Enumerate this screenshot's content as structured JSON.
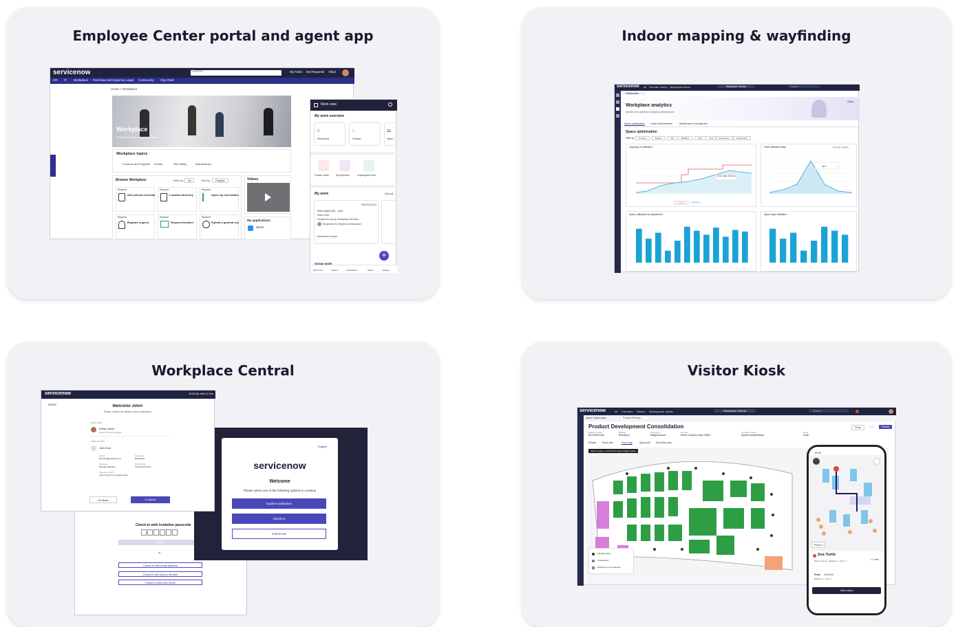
{
  "cards": [
    {
      "title": "Employee Center portal and agent app"
    },
    {
      "title": "Indoor mapping & wayfinding"
    },
    {
      "title": "Workplace Central"
    },
    {
      "title": "Visitor Kiosk"
    }
  ],
  "ec": {
    "logo": "servicenow",
    "search": "Search",
    "nav_links": [
      "My Tasks",
      "My Requests",
      "Viktor"
    ],
    "menu": [
      "HR",
      "IT",
      "Workplace",
      "Purchase and Expense",
      "Legal",
      "Community",
      "Org Chart"
    ],
    "breadcrumb": "Home  >  Workplace",
    "hero_title": "Workplace",
    "hero_sub": "Solutions to your workplace needs",
    "topics_title": "Workplace topics",
    "topics": [
      "Furniture and Supplies",
      "Events",
      "Site Safety",
      "Maintenance"
    ],
    "browse_title": "Browse Workplace",
    "filter_label": "Filter by:",
    "filter_value": "All",
    "sort_label": "Sort by:",
    "sort_value": "Popular",
    "items": [
      {
        "title": "New pinned reservation",
        "badge": "Request"
      },
      {
        "title": "Location directory",
        "badge": "Request"
      },
      {
        "title": "Open my reservation list",
        "badge": "Request"
      },
      {
        "title": "Register a guest",
        "badge": "Request"
      },
      {
        "title": "Request furniture",
        "badge": "Request"
      },
      {
        "title": "Submit a general request",
        "badge": "Request"
      }
    ],
    "videos_title": "Videos",
    "apps_title": "My applications",
    "app_name": "Zoom",
    "side_tab": "Get Help"
  },
  "agent": {
    "header": "Work view",
    "overview_title": "My work overview",
    "stats": [
      {
        "value": "0",
        "label": "Breached",
        "color": "#e0453a"
      },
      {
        "value": "0",
        "label": "Critical",
        "color": "#e8a317"
      },
      {
        "value": "11",
        "label": "Open",
        "color": "#1d1a2e"
      }
    ],
    "actions": [
      "Create a task",
      "My schedule",
      "Unassigned work"
    ],
    "mywork_title": "My work",
    "see_all": "See all",
    "task_id": "WMS0001103",
    "task_title": "Plan Maint 001 - auh",
    "task_state": "State Draft",
    "task_group": "Assignment group Workplace Services",
    "task_req": "Requested for System Administrator",
    "task_loc": "Workplace location",
    "group_title": "Group work",
    "tabs": [
      "Work view",
      "Articles",
      "Notifications",
      "Saved",
      "Settings"
    ]
  },
  "ana": {
    "logo": "servicenow",
    "top": [
      "All",
      "Favorites",
      "History",
      "Workspaces",
      "Studio"
    ],
    "central": "Workplace Central",
    "search": "Search",
    "tab": "Dashboards",
    "title": "Workplace analytics",
    "subtitle": "Monitor and optimise workplace performance",
    "close": "Close",
    "subtabs": [
      "Space optimisation",
      "Lease administration",
      "Maintenance management"
    ],
    "section": "Space optimisation",
    "filter_label": "Filter by",
    "filters": [
      "Campus",
      "Region",
      "Site",
      "Building",
      "Floor",
      "Area",
      "Cost Center",
      "Department"
    ],
    "chart1_title": "Capacity vs utilisation",
    "chart2_title": "Peak utilisation days",
    "chart2_avg": "Average capacity",
    "chart3_title": "Space utilisation by department",
    "chart4_title": "Space type utilisation",
    "legend": [
      "Capacity",
      "Utilisation"
    ],
    "tooltip": "26 Nov 2023, 10:00 AM",
    "tip_value": "44%"
  },
  "wc": {
    "logo": "servicenow",
    "time": "10:00 AM, Wed 12 Feb",
    "back": "Home",
    "welcome": "Welcome John!",
    "confirm": "Please confirm the details of your visit below.",
    "host_label": "HOST INFO",
    "host_name": "Emily Carter",
    "host_role": "Senior Product Manager",
    "visitor_label": "VISITOR INFO",
    "visitor_name": "John Doe",
    "field_labels": [
      "Email",
      "Company",
      "Visit type",
      "Arrival time",
      "Purpose of visit"
    ],
    "field_values": [
      "john.doe@example.com",
      "BlueCloud",
      "Business Meeting",
      "10:00 AM 12 Feb",
      "John is here for a product demo"
    ],
    "go_back": "Go Back",
    "continue": "Continue",
    "checkin_title": "Check-in with invitation passcode",
    "continue2": "Continue",
    "or": "or",
    "checkin_opts": [
      "Check-in with email address",
      "Check-in with phone number",
      "Check-in with your name"
    ]
  },
  "kiosk": {
    "lang": "English",
    "logo": "servicenow",
    "welcome": "Welcome",
    "prompt": "Please select one of the following options to continue",
    "buttons": [
      "Explore workplace",
      "Check-in",
      "Check-out"
    ]
  },
  "vk": {
    "logo": "servicenow",
    "top": [
      "All",
      "Favorites",
      "History",
      "Workspaces",
      "Admin"
    ],
    "central": "Workplace Central",
    "search": "Search",
    "tabs": [
      "Space Optimization",
      "Product Develop..."
    ],
    "title": "Product Development Consolidation",
    "fields": [
      "Building number",
      "Building",
      "Grouped by",
      "Location",
      "Complete request",
      "Stage"
    ],
    "values": [
      "BLDG0001032",
      "Building A",
      "Neighborhood",
      "Demo Campus, Italy, EMEA",
      "System Administrator",
      "Draft"
    ],
    "btns": [
      "Close",
      "Save",
      "Publish"
    ],
    "subtabs": [
      "Details",
      "Stack plan",
      "Floor map",
      "Approvals",
      "Executive plan"
    ],
    "hint": "Select a space, or hold shift to select multiple spaces",
    "legend": [
      "Flexible space",
      "Unassigned",
      "Assigned to an employee"
    ],
    "phone_time": "12:00",
    "floor": "Floor 2",
    "dest": "Sea Turtle",
    "dest_sub": "Marine Sense · Building A · Floor 2",
    "eta": "< 1 min",
    "from_label": "From",
    "from": "A3.05.03",
    "from_sub": "Building A · Floor 2",
    "view": "View steps"
  }
}
